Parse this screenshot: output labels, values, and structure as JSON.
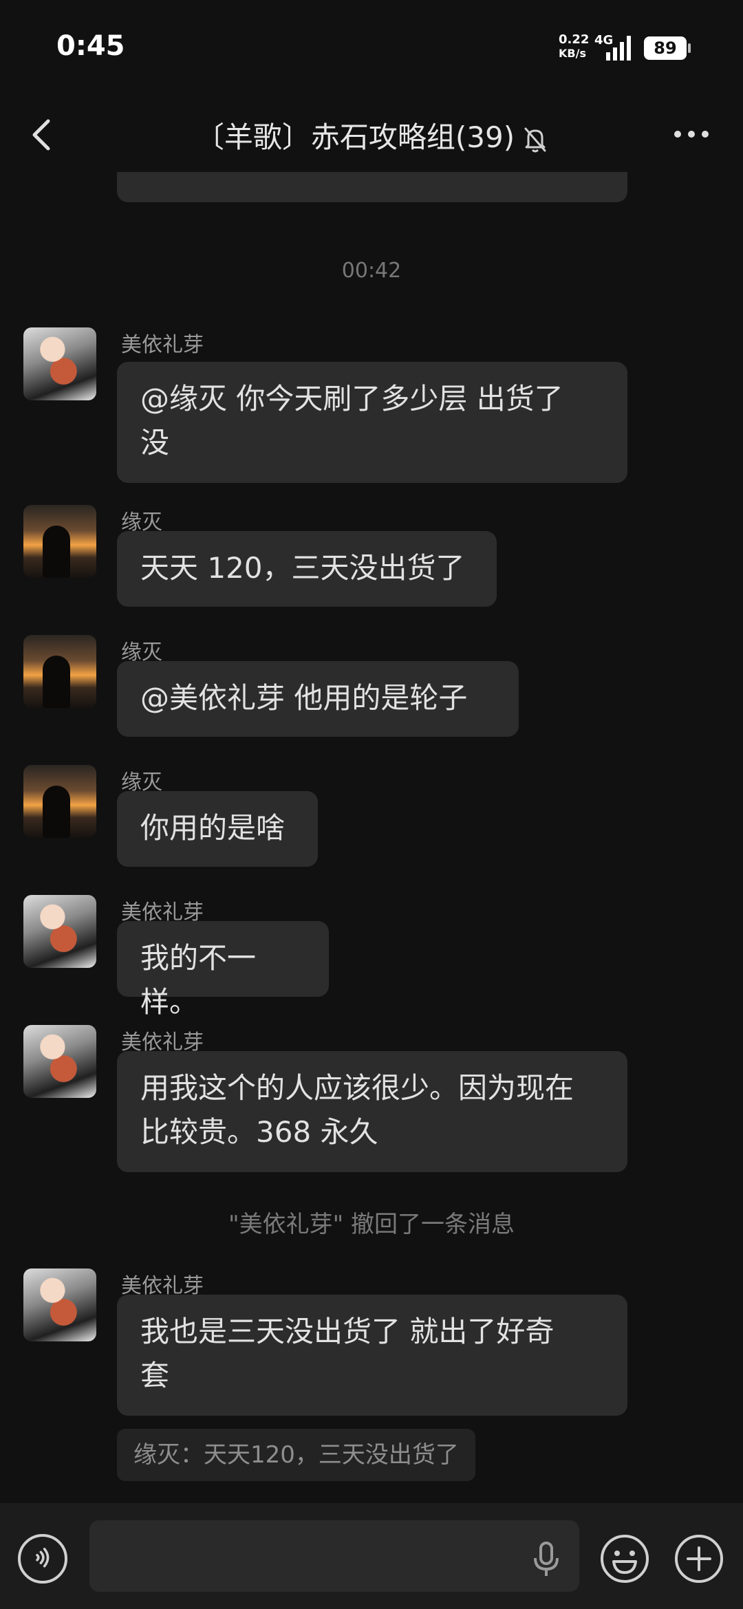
{
  "status_bar": {
    "time": "0:45",
    "net_speed": "0.22",
    "net_speed_unit": "KB/s",
    "net_type": "4G",
    "battery": "89"
  },
  "header": {
    "title": "〔羊歌〕赤石攻略组(39)",
    "icons": {
      "back": "chevron-left-icon",
      "mute": "bell-off-icon",
      "more": "more-dots-icon"
    }
  },
  "chat": {
    "timestamp": "00:42",
    "messages": [
      {
        "sender": "美依礼芽",
        "avatar": "avatar-meiyi",
        "lines": [
          "@缘灭  你今天刷了多少层  出货了",
          "没"
        ]
      },
      {
        "sender": "缘灭",
        "avatar": "avatar-yuanmie",
        "lines": [
          "天天 120，三天没出货了"
        ]
      },
      {
        "sender": "缘灭",
        "avatar": "avatar-yuanmie",
        "lines": [
          "@美依礼芽  他用的是轮子"
        ]
      },
      {
        "sender": "缘灭",
        "avatar": "avatar-yuanmie",
        "lines": [
          "你用的是啥"
        ]
      },
      {
        "sender": "美依礼芽",
        "avatar": "avatar-meiyi",
        "lines": [
          "我的不一样。"
        ]
      },
      {
        "sender": "美依礼芽",
        "avatar": "avatar-meiyi",
        "lines": [
          "用我这个的人应该很少。因为现在",
          "比较贵。368 永久"
        ]
      },
      {
        "sender": "美依礼芽",
        "avatar": "avatar-meiyi",
        "lines": [
          "我也是三天没出货了  就出了好奇",
          "套"
        ]
      }
    ],
    "recall_notice": "\"美依礼芽\" 撤回了一条消息",
    "quote": "缘灭：天天120，三天没出货了"
  },
  "input_bar": {
    "placeholder": "",
    "icons": {
      "voice": "voice-icon",
      "mic": "mic-icon",
      "emoji": "emoji-icon",
      "plus": "plus-icon"
    }
  }
}
